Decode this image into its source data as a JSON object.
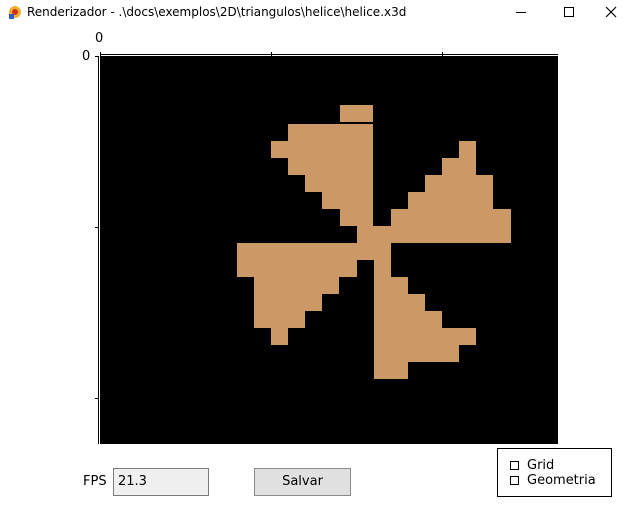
{
  "window": {
    "title": "Renderizador - .\\docs\\exemplos\\2D\\triangulos\\helice\\helice.x3d",
    "app_icon": "renderer-app-icon",
    "controls": [
      "minimize-icon",
      "maximize-icon",
      "close-icon"
    ]
  },
  "viewport": {
    "x_origin_label": "0",
    "y_origin_label": "0",
    "background": "#000000",
    "shape_color": "#cc9966",
    "shape": "pixelated four-blade propeller"
  },
  "controls": {
    "fps_label": "FPS",
    "fps_value": "21.3",
    "save_label": "Salvar",
    "options": [
      {
        "label": "Grid",
        "checked": false
      },
      {
        "label": "Geometria",
        "checked": false
      }
    ]
  }
}
